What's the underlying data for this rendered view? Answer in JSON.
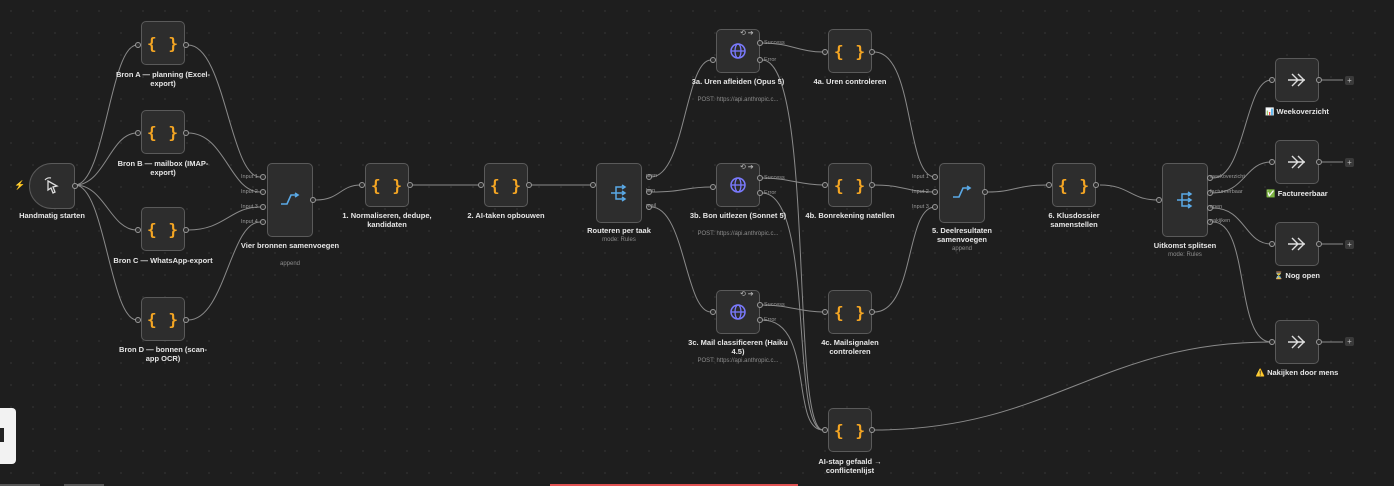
{
  "colors": {
    "canvas": "#1e1e1e",
    "node": "#2d2d2d",
    "edge": "#8a8a8a",
    "code": "#f5a623",
    "merge": "#5aa9e6",
    "http": "#7b7bff",
    "danger": "#e05252"
  },
  "nodes": {
    "trigger": {
      "label": "Handmatig starten",
      "icon": "cursor-click-icon"
    },
    "bron_a": {
      "label": "Bron A — planning (Excel-export)",
      "icon": "code-braces-icon"
    },
    "bron_b": {
      "label": "Bron B — mailbox (IMAP-export)",
      "icon": "code-braces-icon"
    },
    "bron_c": {
      "label": "Bron C — WhatsApp-export",
      "icon": "code-braces-icon"
    },
    "bron_d": {
      "label": "Bron D — bonnen (scan-app OCR)",
      "icon": "code-braces-icon"
    },
    "merge1": {
      "label": "Vier bronnen samenvoegen",
      "sub": "append",
      "inputs": [
        "Input 1",
        "Input 2",
        "Input 3",
        "Input 4"
      ]
    },
    "normalize": {
      "label": "1. Normaliseren, dedupe, kandidaten"
    },
    "ai_tasks": {
      "label": "2. AI-taken opbouwen"
    },
    "router": {
      "label": "Routeren per taak",
      "sub": "mode: Rules",
      "outputs": [
        "uren",
        "bon",
        "mail"
      ]
    },
    "http_a": {
      "label": "3a. Uren afleiden (Opus 5)",
      "sub": "POST: https://api.anthropic.c...",
      "outputs": [
        "Success",
        "Error"
      ]
    },
    "http_b": {
      "label": "3b. Bon uitlezen (Sonnet 5)",
      "sub": "POST: https://api.anthropic.c...",
      "outputs": [
        "Success",
        "Error"
      ]
    },
    "http_c": {
      "label": "3c. Mail classificeren (Haiku 4.5)",
      "sub": "POST: https://api.anthropic.c...",
      "outputs": [
        "Success",
        "Error"
      ]
    },
    "check_a": {
      "label": "4a. Uren controleren"
    },
    "check_b": {
      "label": "4b. Bonrekening natellen"
    },
    "check_c": {
      "label": "4c. Mailsignalen controleren"
    },
    "failed": {
      "label": "AI-stap gefaald → conflictenlijst"
    },
    "merge2": {
      "label": "5. Deelresultaten samenvoegen",
      "sub": "append",
      "inputs": [
        "Input 1",
        "Input 2",
        "Input 3"
      ]
    },
    "dossier": {
      "label": "6. Klusdossier samenstellen"
    },
    "split": {
      "label": "Uitkomst splitsen",
      "sub": "mode: Rules",
      "outputs": [
        "weekoverzicht",
        "factureerbaar",
        "open",
        "nakijken"
      ]
    },
    "out_week": {
      "label": "📊 Weekoverzicht"
    },
    "out_fact": {
      "label": "✅ Factureerbaar"
    },
    "out_open": {
      "label": "⏳ Nog open"
    },
    "out_mens": {
      "label": "⚠️ Nakijken door mens"
    }
  }
}
